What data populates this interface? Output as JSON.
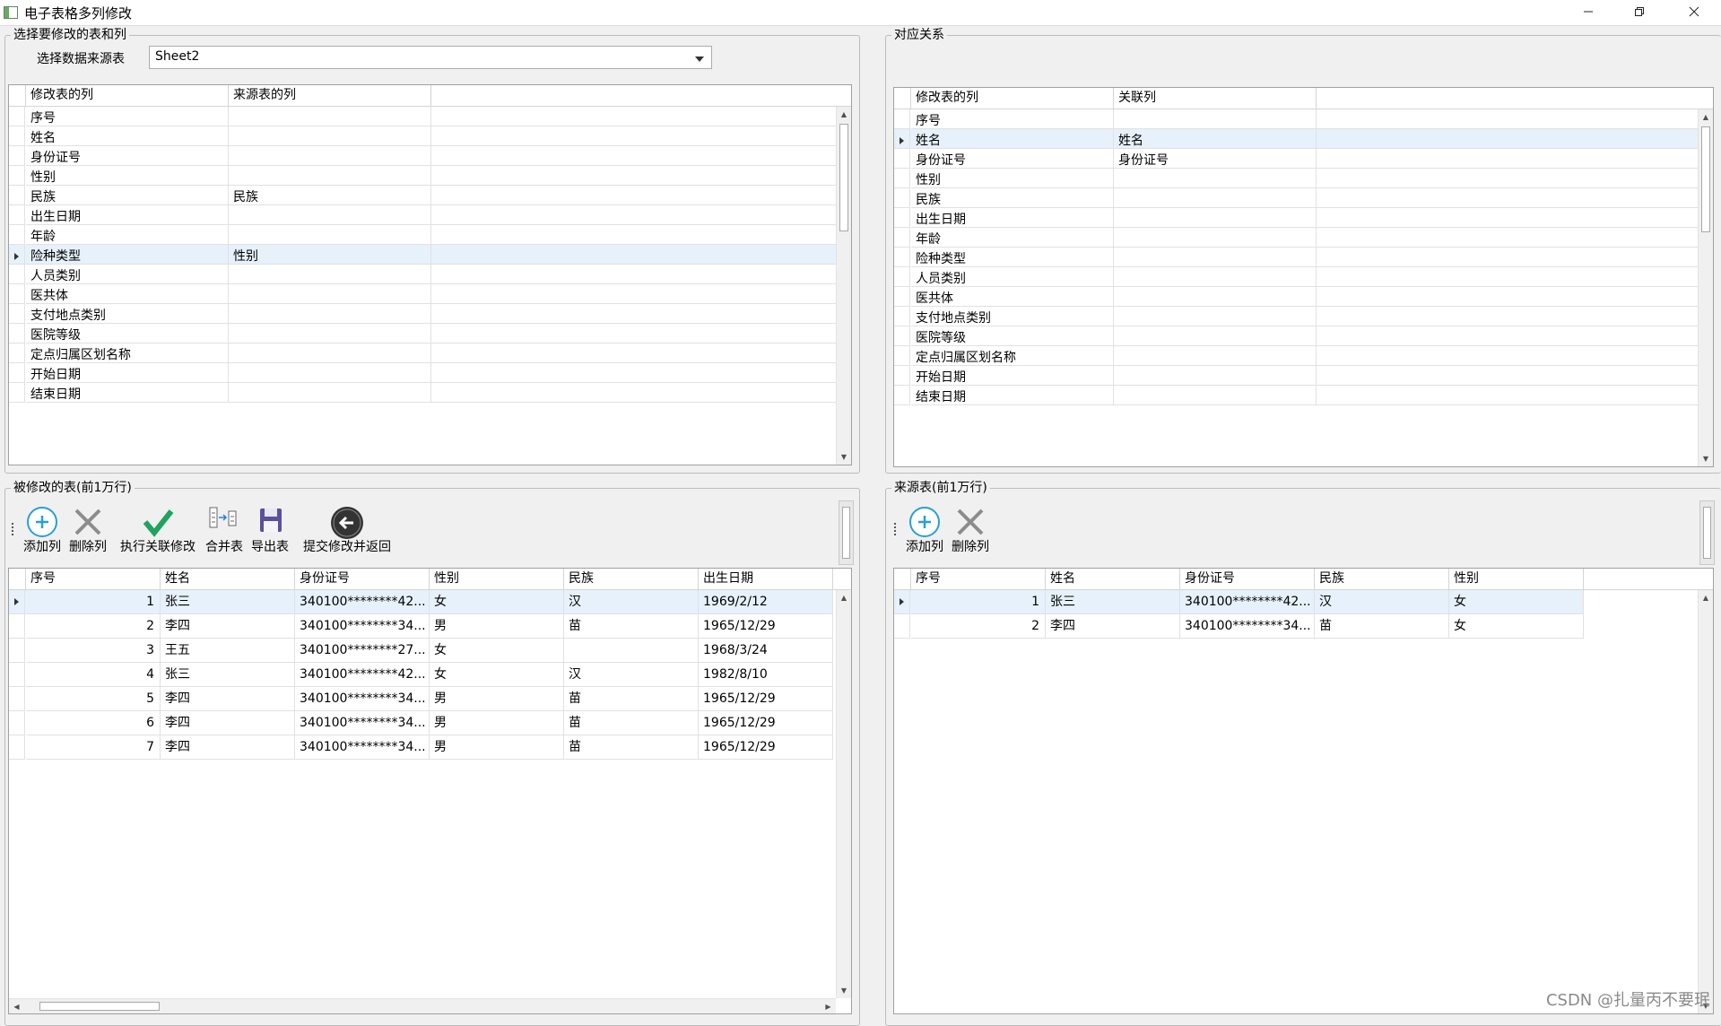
{
  "window": {
    "title": "电子表格多列修改",
    "min_icon": "minimize-icon",
    "max_icon": "restore-icon",
    "close_icon": "close-icon"
  },
  "select_group": {
    "title": "选择要修改的表和列",
    "source_label": "选择数据来源表",
    "source_value": "Sheet2"
  },
  "mapping_grid": {
    "headers": [
      "修改表的列",
      "来源表的列"
    ],
    "rows": [
      {
        "a": "序号",
        "b": ""
      },
      {
        "a": "姓名",
        "b": ""
      },
      {
        "a": "身份证号",
        "b": ""
      },
      {
        "a": "性别",
        "b": ""
      },
      {
        "a": "民族",
        "b": "民族"
      },
      {
        "a": "出生日期",
        "b": ""
      },
      {
        "a": "年龄",
        "b": ""
      },
      {
        "a": "险种类型",
        "b": "性别",
        "selected": true
      },
      {
        "a": "人员类别",
        "b": ""
      },
      {
        "a": "医共体",
        "b": ""
      },
      {
        "a": "支付地点类别",
        "b": ""
      },
      {
        "a": "医院等级",
        "b": ""
      },
      {
        "a": "定点归属区划名称",
        "b": ""
      },
      {
        "a": "开始日期",
        "b": ""
      },
      {
        "a": "结束日期",
        "b": ""
      }
    ]
  },
  "relation_group": {
    "title": "对应关系",
    "headers": [
      "修改表的列",
      "关联列"
    ],
    "rows": [
      {
        "a": "序号",
        "b": ""
      },
      {
        "a": "姓名",
        "b": "姓名",
        "selected": true
      },
      {
        "a": "身份证号",
        "b": "身份证号"
      },
      {
        "a": "性别",
        "b": ""
      },
      {
        "a": "民族",
        "b": ""
      },
      {
        "a": "出生日期",
        "b": ""
      },
      {
        "a": "年龄",
        "b": ""
      },
      {
        "a": "险种类型",
        "b": ""
      },
      {
        "a": "人员类别",
        "b": ""
      },
      {
        "a": "医共体",
        "b": ""
      },
      {
        "a": "支付地点类别",
        "b": ""
      },
      {
        "a": "医院等级",
        "b": ""
      },
      {
        "a": "定点归属区划名称",
        "b": ""
      },
      {
        "a": "开始日期",
        "b": ""
      },
      {
        "a": "结束日期",
        "b": ""
      }
    ]
  },
  "target_group": {
    "title": "被修改的表(前1万行)",
    "toolbar": {
      "add_column": "添加列",
      "delete_column": "删除列",
      "execute": "执行关联修改",
      "merge": "合并表",
      "export": "导出表",
      "submit": "提交修改并返回"
    },
    "headers": [
      "序号",
      "姓名",
      "身份证号",
      "性别",
      "民族",
      "出生日期"
    ],
    "rows": [
      [
        "1",
        "张三",
        "340100********42...",
        "女",
        "汉",
        "1969/2/12"
      ],
      [
        "2",
        "李四",
        "340100********34...",
        "男",
        "苗",
        "1965/12/29"
      ],
      [
        "3",
        "王五",
        "340100********27...",
        "女",
        "",
        "1968/3/24"
      ],
      [
        "4",
        "张三",
        "340100********42...",
        "女",
        "汉",
        "1982/8/10"
      ],
      [
        "5",
        "李四",
        "340100********34...",
        "男",
        "苗",
        "1965/12/29"
      ],
      [
        "6",
        "李四",
        "340100********34...",
        "男",
        "苗",
        "1965/12/29"
      ],
      [
        "7",
        "李四",
        "340100********34...",
        "男",
        "苗",
        "1965/12/29"
      ]
    ]
  },
  "source_group": {
    "title": "来源表(前1万行)",
    "toolbar": {
      "add_column": "添加列",
      "delete_column": "删除列"
    },
    "headers": [
      "序号",
      "姓名",
      "身份证号",
      "民族",
      "性别"
    ],
    "rows": [
      [
        "1",
        "张三",
        "340100********42...",
        "汉",
        "女"
      ],
      [
        "2",
        "李四",
        "340100********34...",
        "苗",
        "女"
      ]
    ]
  },
  "watermark": "CSDN @扎量丙不要珉",
  "colors": {
    "selected_row": "#e6f1fb",
    "add_icon": "#2a9fd6",
    "delete_icon": "#8c8c8c",
    "check_icon": "#1fa35f",
    "save_icon": "#5c4f9c",
    "back_icon": "#333333"
  }
}
